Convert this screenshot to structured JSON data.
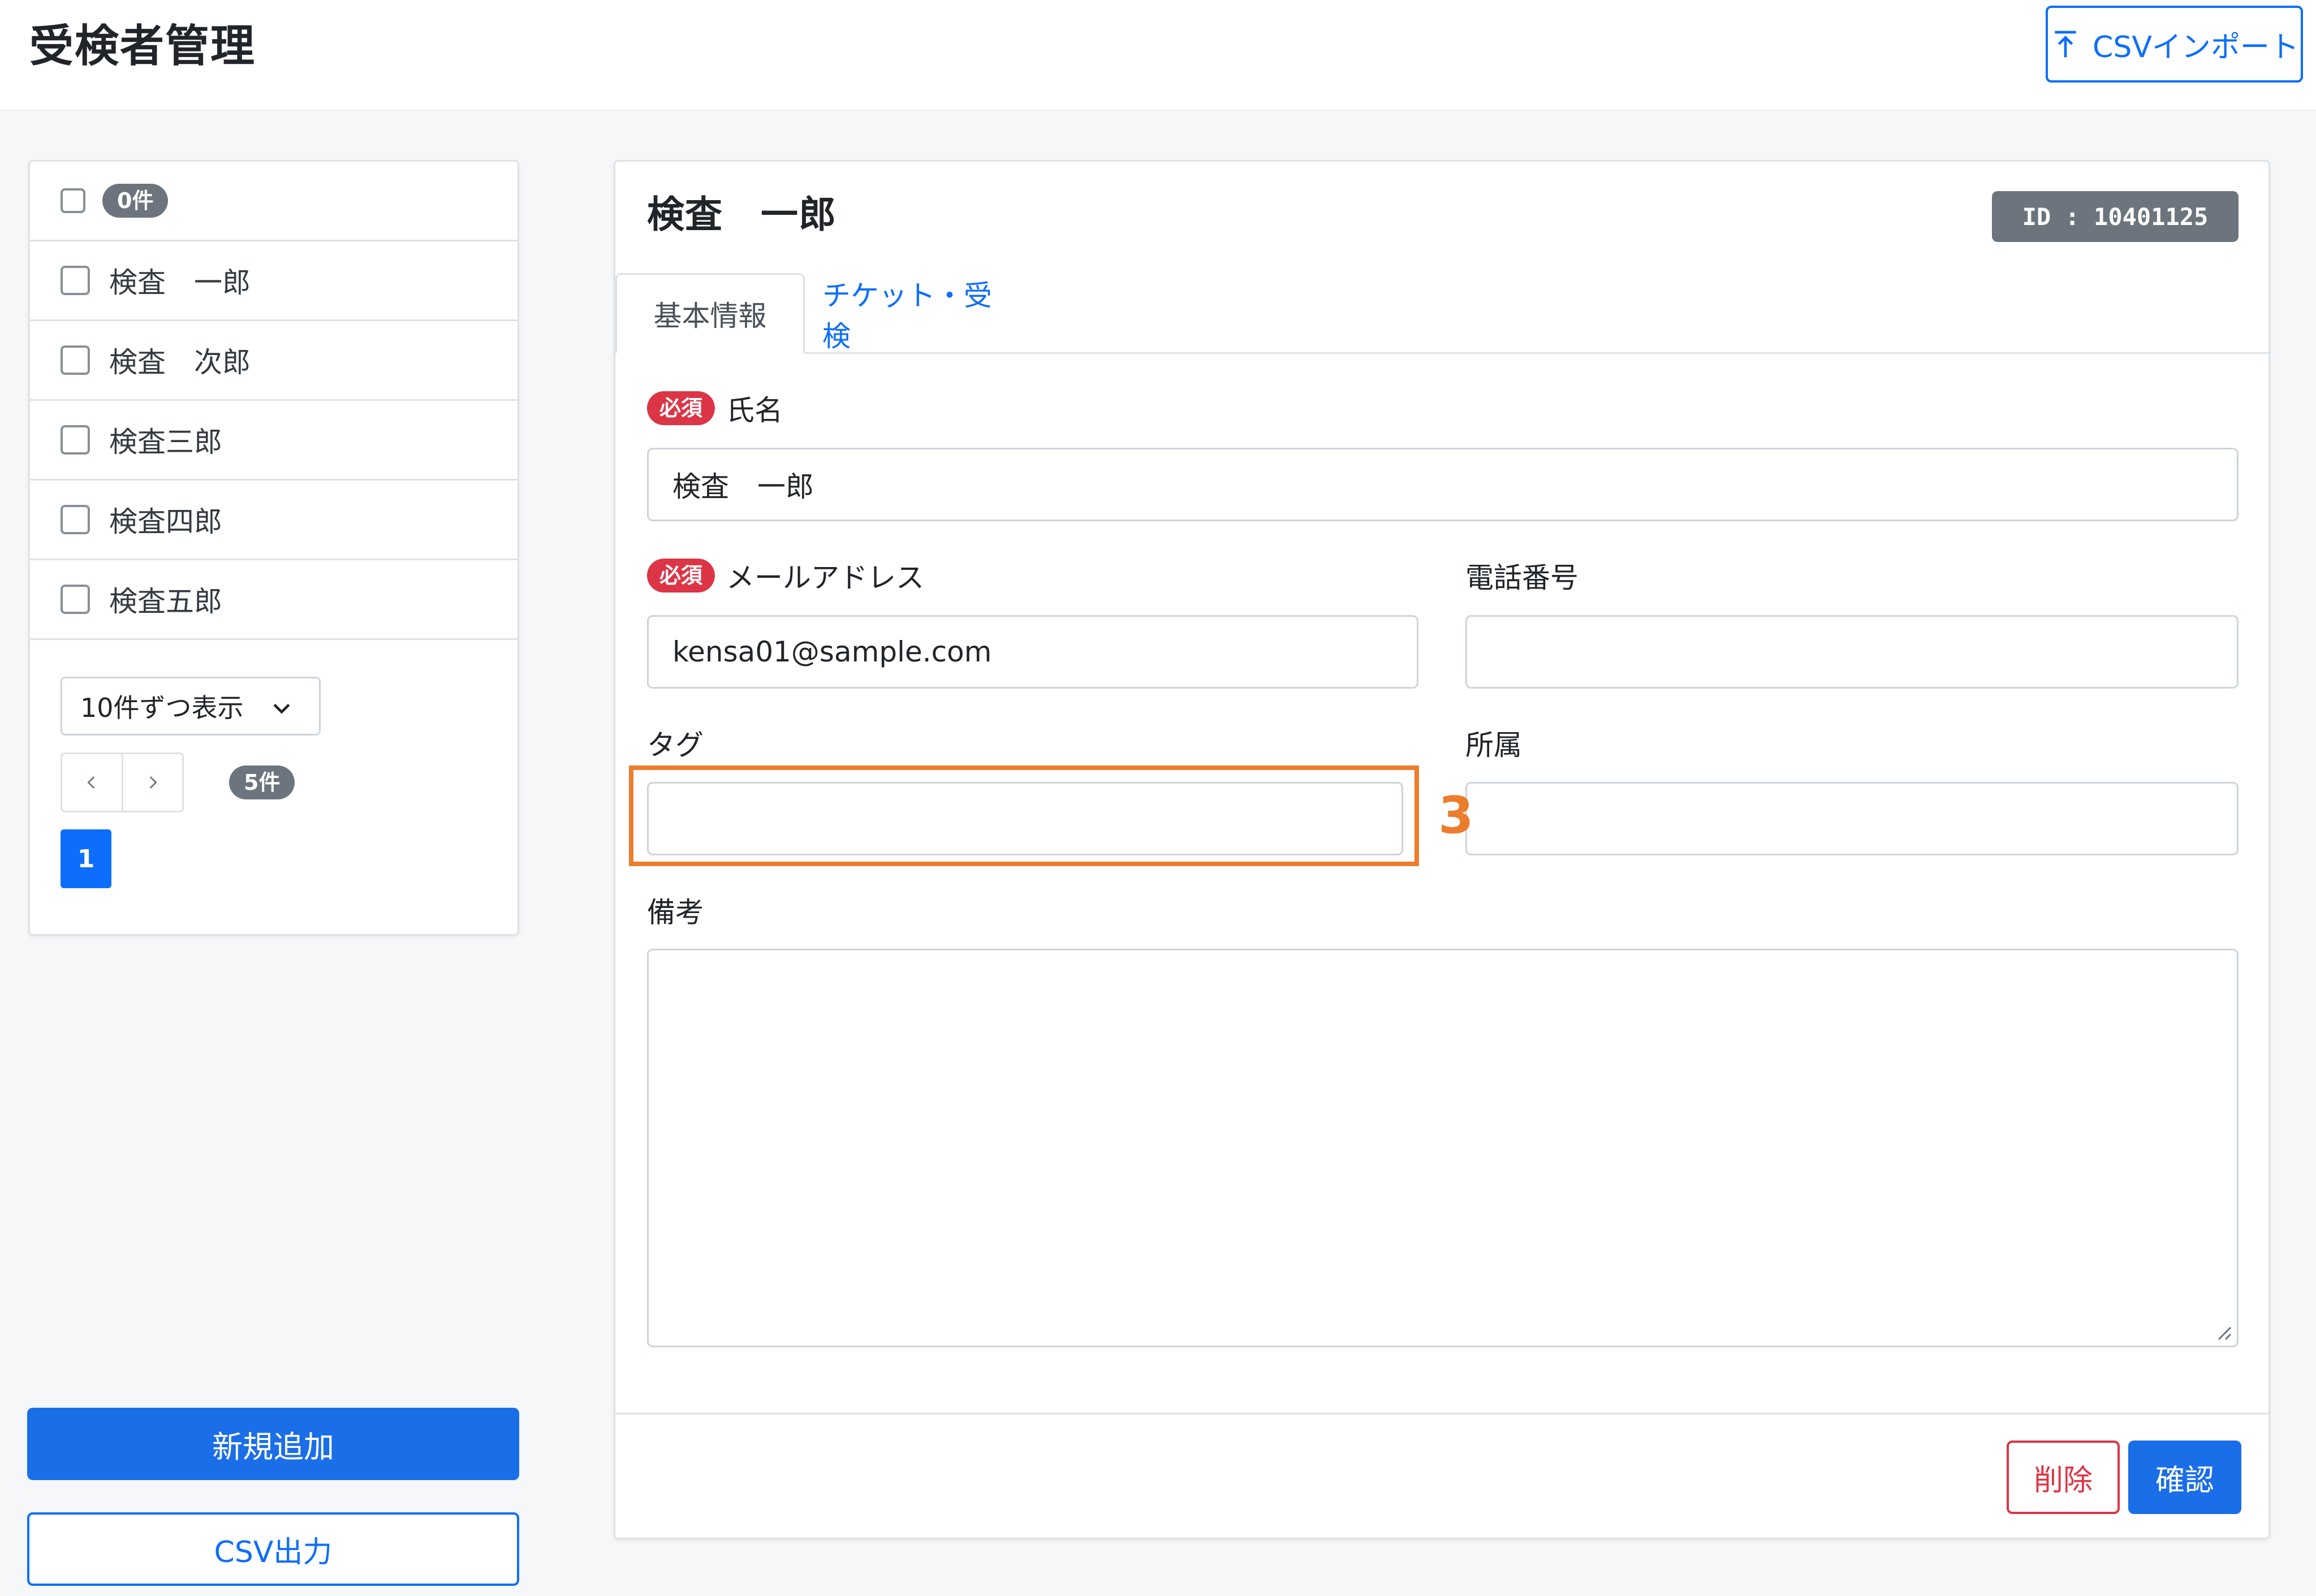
{
  "header": {
    "title": "受検者管理",
    "csv_import_label": "CSVインポート"
  },
  "list": {
    "select_all_count": "0件",
    "items": [
      {
        "name": "検査　一郎"
      },
      {
        "name": "検査　次郎"
      },
      {
        "name": "検査三郎"
      },
      {
        "name": "検査四郎"
      },
      {
        "name": "検査五郎"
      }
    ],
    "per_page_selected": "10件ずつ表示",
    "total_count": "5件",
    "current_page": "1"
  },
  "sidebar_actions": {
    "add_label": "新規追加",
    "csv_export_label": "CSV出力"
  },
  "detail": {
    "name": "検査　一郎",
    "id_badge": "ID : 10401125",
    "tabs": [
      {
        "label": "基本情報",
        "active": true
      },
      {
        "label": "チケット・受検",
        "active": false
      }
    ],
    "required_badge": "必須",
    "fields": {
      "name_label": "氏名",
      "name_value": "検査　一郎",
      "email_label": "メールアドレス",
      "email_value": "kensa01@sample.com",
      "phone_label": "電話番号",
      "phone_value": "",
      "tag_label": "タグ",
      "tag_value": "",
      "affiliation_label": "所属",
      "affiliation_value": "",
      "notes_label": "備考",
      "notes_value": ""
    },
    "delete_label": "削除",
    "confirm_label": "確認"
  },
  "annotation": {
    "number": "3",
    "color": "#ec7d2c"
  },
  "colors": {
    "primary": "#0d6efd",
    "danger": "#dc3545",
    "secondary": "#6c757d"
  }
}
